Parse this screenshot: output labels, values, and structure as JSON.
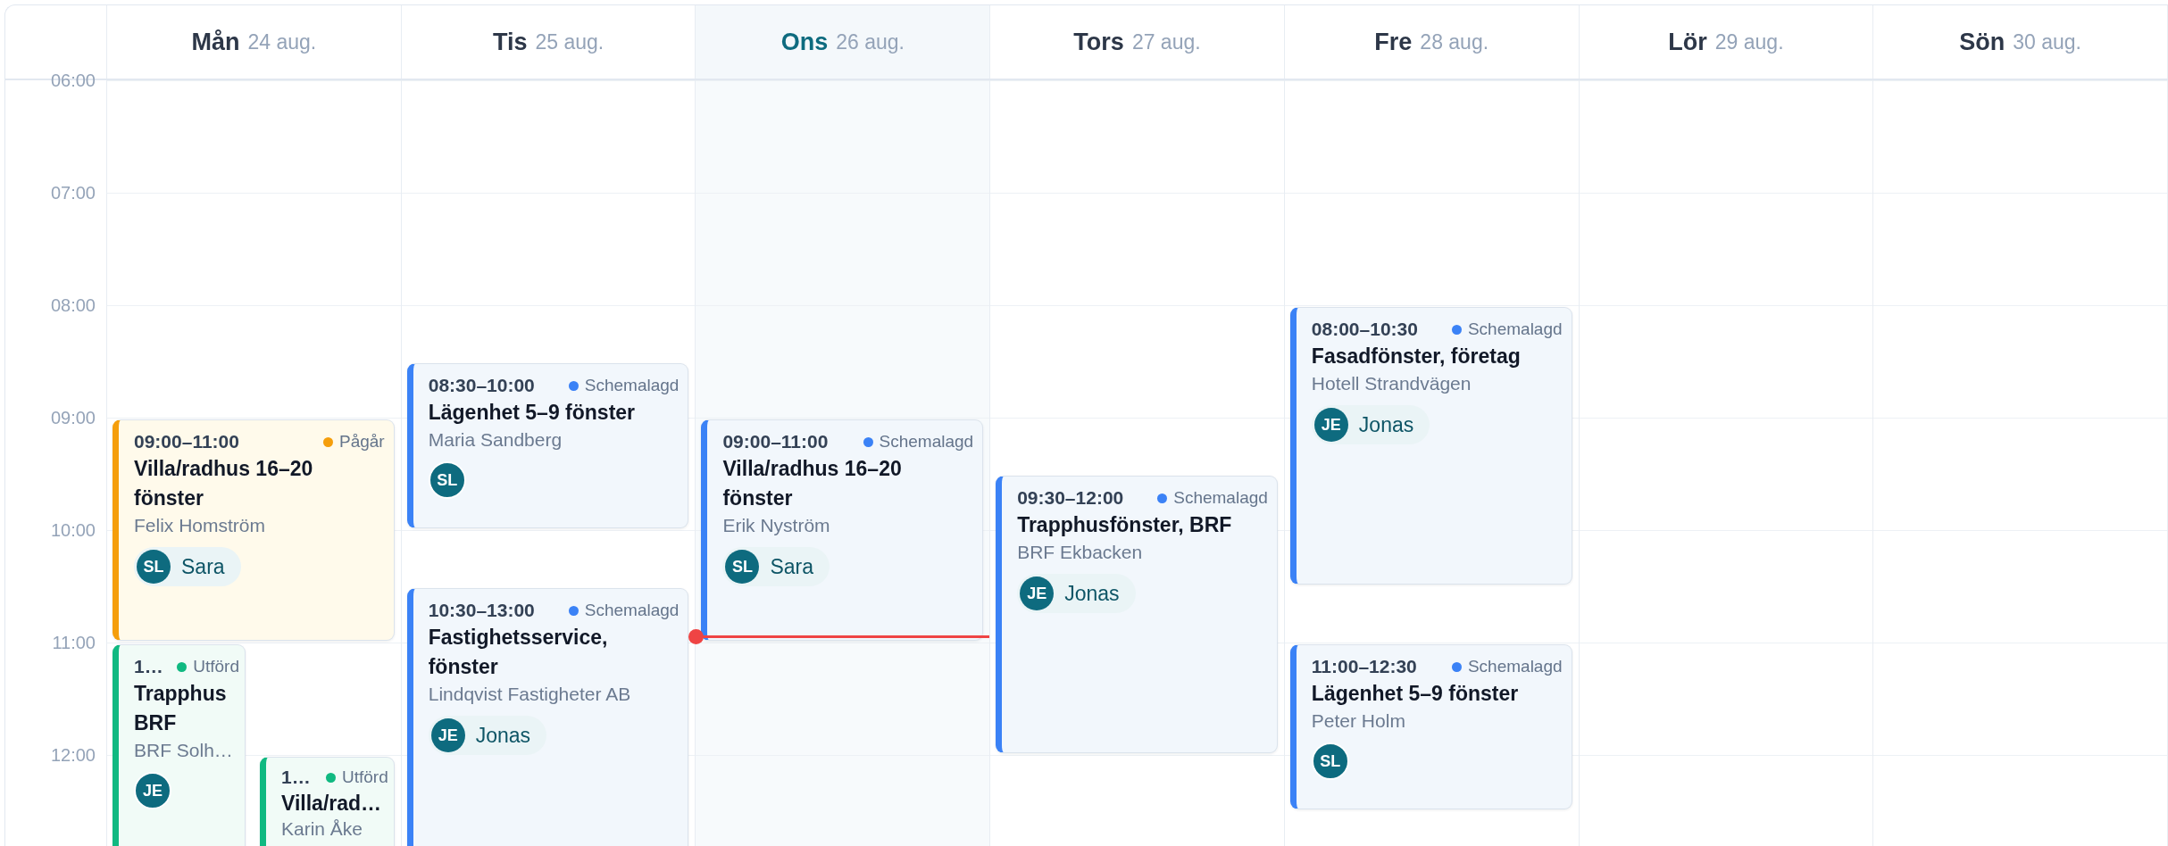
{
  "time_labels": [
    "06:00",
    "07:00",
    "08:00",
    "09:00",
    "10:00",
    "11:00",
    "12:00"
  ],
  "days": [
    {
      "name": "Mån",
      "date": "24 aug.",
      "today": false,
      "events": [
        {
          "kind": "full",
          "time": "09:00–11:00",
          "status": {
            "kind": "in_progress",
            "label": "Pågår"
          },
          "title": "Villa/radhus 16–20 fönster",
          "client": "Felix Homström",
          "assignee": {
            "initials": "SL",
            "name": "Sara"
          }
        },
        {
          "kind": "left",
          "time": "1…",
          "status": {
            "kind": "done",
            "label": "Utförd"
          },
          "title": "Trapphus BRF",
          "client": "BRF Solh…",
          "assignee": {
            "initials": "JE"
          }
        },
        {
          "kind": "right",
          "time": "1…",
          "status": {
            "kind": "done",
            "label": "Utförd"
          },
          "title": "Villa/rad…",
          "client": "Karin Åke"
        }
      ]
    },
    {
      "name": "Tis",
      "date": "25 aug.",
      "today": false,
      "events": [
        {
          "kind": "full",
          "time": "08:30–10:00",
          "status": {
            "kind": "scheduled",
            "label": "Schemalagd"
          },
          "title": "Lägenhet 5–9 fönster",
          "client": "Maria Sandberg",
          "assignee": {
            "initials": "SL"
          }
        },
        {
          "kind": "full",
          "time": "10:30–13:00",
          "status": {
            "kind": "scheduled",
            "label": "Schemalagd"
          },
          "title": "Fastighetsservice, fönster",
          "client": "Lindqvist Fastigheter AB",
          "assignee": {
            "initials": "JE",
            "name": "Jonas"
          }
        }
      ]
    },
    {
      "name": "Ons",
      "date": "26 aug.",
      "today": true,
      "events": [
        {
          "kind": "full",
          "time": "09:00–11:00",
          "status": {
            "kind": "scheduled",
            "label": "Schemalagd"
          },
          "title": "Villa/radhus 16–20 fönster",
          "client": "Erik Nyström",
          "assignee": {
            "initials": "SL",
            "name": "Sara"
          }
        }
      ]
    },
    {
      "name": "Tors",
      "date": "27 aug.",
      "today": false,
      "events": [
        {
          "kind": "full",
          "time": "09:30–12:00",
          "status": {
            "kind": "scheduled",
            "label": "Schemalagd"
          },
          "title": "Trapphusfönster, BRF",
          "client": "BRF Ekbacken",
          "assignee": {
            "initials": "JE",
            "name": "Jonas"
          }
        }
      ]
    },
    {
      "name": "Fre",
      "date": "28 aug.",
      "today": false,
      "events": [
        {
          "kind": "full",
          "time": "08:00–10:30",
          "status": {
            "kind": "scheduled",
            "label": "Schemalagd"
          },
          "title": "Fasadfönster, företag",
          "client": "Hotell Strandvägen",
          "assignee": {
            "initials": "JE",
            "name": "Jonas"
          }
        },
        {
          "kind": "full",
          "time": "11:00–12:30",
          "status": {
            "kind": "scheduled",
            "label": "Schemalagd"
          },
          "title": "Lägenhet 5–9 fönster",
          "client": "Peter Holm",
          "assignee": {
            "initials": "SL"
          }
        }
      ]
    },
    {
      "name": "Lör",
      "date": "29 aug.",
      "today": false
    },
    {
      "name": "Sön",
      "date": "30 aug.",
      "today": false
    }
  ]
}
